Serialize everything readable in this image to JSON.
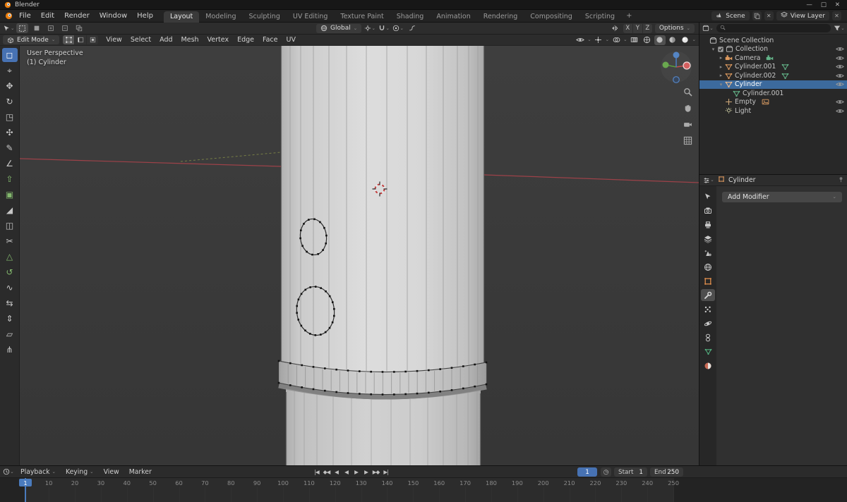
{
  "titlebar": {
    "app_name": "Blender"
  },
  "topbar": {
    "menus": [
      "File",
      "Edit",
      "Render",
      "Window",
      "Help"
    ],
    "workspace_tabs": [
      {
        "label": "Layout",
        "active": true
      },
      {
        "label": "Modeling"
      },
      {
        "label": "Sculpting"
      },
      {
        "label": "UV Editing"
      },
      {
        "label": "Texture Paint"
      },
      {
        "label": "Shading"
      },
      {
        "label": "Animation"
      },
      {
        "label": "Rendering"
      },
      {
        "label": "Compositing"
      },
      {
        "label": "Scripting"
      }
    ],
    "add_workspace": "+",
    "scene": {
      "label": "Scene"
    },
    "view_layer": {
      "label": "View Layer"
    }
  },
  "tool_settings": {
    "orientation": "Global",
    "mirror_axes": [
      "X",
      "Y",
      "Z"
    ],
    "options_label": "Options"
  },
  "viewport": {
    "mode_selector": "Edit Mode",
    "menus": [
      "View",
      "Select",
      "Add",
      "Mesh",
      "Vertex",
      "Edge",
      "Face",
      "UV"
    ],
    "overlay_text": {
      "perspective": "User Perspective",
      "active_object": "(1) Cylinder"
    },
    "header_icons": [
      "visibility",
      "gizmo",
      "overlays",
      "xray",
      "shade-wireframe",
      "shade-solid",
      "shade-material",
      "shade-rendered"
    ],
    "shading_active": "shade-solid",
    "side_icons": [
      "zoom",
      "hand",
      "camera-view",
      "ortho-grid"
    ]
  },
  "toolbar": {
    "tools": [
      {
        "name": "select-box",
        "glyph": "◻",
        "active": true
      },
      {
        "name": "cursor",
        "glyph": "⌖"
      },
      {
        "name": "move",
        "glyph": "✥"
      },
      {
        "name": "rotate",
        "glyph": "↻"
      },
      {
        "name": "scale",
        "glyph": "◳"
      },
      {
        "name": "transform",
        "glyph": "✣"
      },
      {
        "name": "annotate",
        "glyph": "✎"
      },
      {
        "name": "measure",
        "glyph": "∠"
      },
      {
        "name": "extrude-region",
        "glyph": "⇧",
        "tint": "green"
      },
      {
        "name": "inset-faces",
        "glyph": "▣",
        "tint": "green"
      },
      {
        "name": "bevel",
        "glyph": "◢"
      },
      {
        "name": "loop-cut",
        "glyph": "◫"
      },
      {
        "name": "knife",
        "glyph": "✂"
      },
      {
        "name": "poly-build",
        "glyph": "△",
        "tint": "green"
      },
      {
        "name": "spin",
        "glyph": "↺",
        "tint": "green"
      },
      {
        "name": "smooth",
        "glyph": "∿"
      },
      {
        "name": "edge-slide",
        "glyph": "⇆"
      },
      {
        "name": "shrink-fatten",
        "glyph": "⇕"
      },
      {
        "name": "shear",
        "glyph": "▱"
      },
      {
        "name": "rip-region",
        "glyph": "⋔"
      }
    ]
  },
  "outliner": {
    "items": [
      {
        "label": "Scene Collection",
        "icon": "scene-collection",
        "depth": 0
      },
      {
        "label": "Collection",
        "icon": "collection",
        "depth": 1,
        "twisty": "down",
        "checkbox": true,
        "eye": true
      },
      {
        "label": "Camera",
        "icon": "camera",
        "depth": 2,
        "twisty": "right",
        "extra": "camera-data",
        "eye": true
      },
      {
        "label": "Cylinder.001",
        "icon": "mesh-object",
        "depth": 2,
        "twisty": "right",
        "extra": "mesh-data",
        "eye": true
      },
      {
        "label": "Cylinder.002",
        "icon": "mesh-object",
        "depth": 2,
        "twisty": "right",
        "extra": "mesh-data",
        "eye": true
      },
      {
        "label": "Cylinder",
        "icon": "mesh-object-active",
        "depth": 2,
        "twisty": "down",
        "selected": true,
        "eye": true
      },
      {
        "label": "Cylinder.001",
        "icon": "mesh-data",
        "depth": 3
      },
      {
        "label": "Empty",
        "icon": "empty",
        "depth": 2,
        "extra": "image-data",
        "eye": true
      },
      {
        "label": "Light",
        "icon": "light",
        "depth": 2,
        "eye": true
      }
    ]
  },
  "properties": {
    "breadcrumb": {
      "object": "Cylinder"
    },
    "add_modifier_label": "Add Modifier",
    "tabs": [
      {
        "name": "tool"
      },
      {
        "name": "render"
      },
      {
        "name": "output"
      },
      {
        "name": "view-layer"
      },
      {
        "name": "scene"
      },
      {
        "name": "world"
      },
      {
        "name": "object"
      },
      {
        "name": "modifiers",
        "active": true
      },
      {
        "name": "particles"
      },
      {
        "name": "physics"
      },
      {
        "name": "constraints"
      },
      {
        "name": "object-data"
      },
      {
        "name": "material"
      }
    ]
  },
  "timeline": {
    "menus": [
      {
        "label": "Playback",
        "arrow": true
      },
      {
        "label": "Keying",
        "arrow": true
      },
      {
        "label": "View"
      },
      {
        "label": "Marker"
      }
    ],
    "transport": [
      {
        "name": "jump-to-start",
        "glyph": "|◀"
      },
      {
        "name": "previous-keyframe",
        "glyph": "◆◀"
      },
      {
        "name": "previous-frame",
        "glyph": "◀"
      },
      {
        "name": "play-reverse",
        "glyph": "◀"
      },
      {
        "name": "play",
        "glyph": "▶"
      },
      {
        "name": "next-frame",
        "glyph": "▶"
      },
      {
        "name": "next-keyframe",
        "glyph": "▶◆"
      },
      {
        "name": "jump-to-end",
        "glyph": "▶|"
      }
    ],
    "current_frame": "1",
    "start": {
      "label": "Start",
      "value": "1"
    },
    "end": {
      "label": "End",
      "value": "250"
    },
    "frame_ticks": [
      10,
      20,
      30,
      40,
      50,
      60,
      70,
      80,
      90,
      100,
      110,
      120,
      130,
      140,
      150,
      160,
      170,
      180,
      190,
      200,
      210,
      220,
      230,
      240,
      250
    ]
  },
  "colors": {
    "accent_blue": "#4772b3",
    "selected_row_blue": "#3c6a9d",
    "object_orange": "#de9a5f",
    "data_green": "#63b489",
    "axis_red": "#a8434b",
    "viewport_bg": "#3a3a3a",
    "mesh_gray": "#d6d6d6"
  }
}
